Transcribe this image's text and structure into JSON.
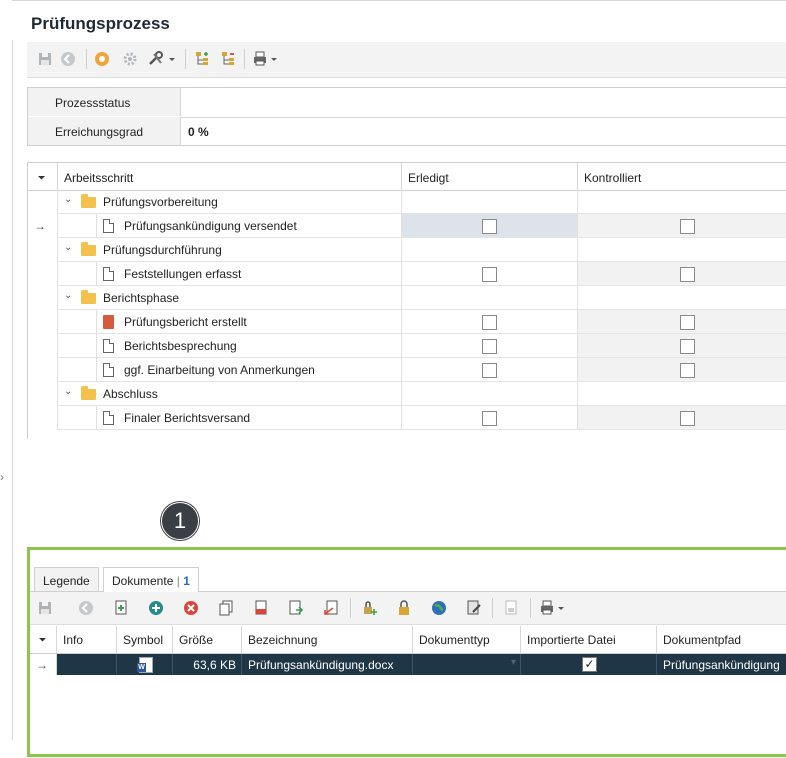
{
  "title": "Prüfungsprozess",
  "fields": [
    {
      "label": "Prozessstatus",
      "value": ""
    },
    {
      "label": "Erreichungsgrad",
      "value": "0 %"
    }
  ],
  "grid": {
    "columns": [
      "Arbeitsschritt",
      "Erledigt",
      "Kontrolliert"
    ],
    "rows": [
      {
        "label": "Prüfungsvorbereitung"
      },
      {
        "label": "Prüfungsankündigung versendet"
      },
      {
        "label": "Prüfungsdurchführung"
      },
      {
        "label": "Feststellungen erfasst"
      },
      {
        "label": "Berichtsphase"
      },
      {
        "label": "Prüfungsbericht erstellt"
      },
      {
        "label": "Berichtsbesprechung"
      },
      {
        "label": "ggf. Einarbeitung von Anmerkungen"
      },
      {
        "label": "Abschluss"
      },
      {
        "label": "Finaler Berichtsversand"
      }
    ]
  },
  "badge": "1",
  "bottom": {
    "tabs": [
      {
        "label": "Legende"
      },
      {
        "label": "Dokumente",
        "sep": "|",
        "count": "1"
      }
    ],
    "columns": [
      "Info",
      "Symbol",
      "Größe",
      "Bezeichnung",
      "Dokumenttyp",
      "Importierte Datei",
      "Dokumentpfad"
    ],
    "row": {
      "groesse": "63,6 KB",
      "bezeichnung": "Prüfungsankündigung.docx",
      "dokumenttyp": "",
      "importiert": "✓",
      "pfad": "Prüfungsankündigung"
    }
  },
  "colors": {
    "accent_border": "#8cc64b",
    "selected_row": "#1e3645"
  }
}
